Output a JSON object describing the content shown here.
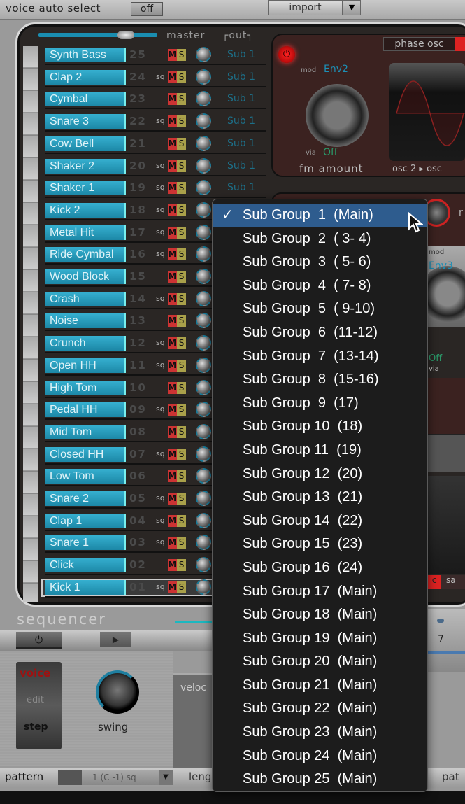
{
  "topbar": {
    "voice_auto_select": "voice auto select",
    "voice_auto_select_value": "off",
    "import_label": "import"
  },
  "mixer": {
    "master_label": "master",
    "out_label": "┌out┐",
    "master_level": 0.7,
    "rows": [
      {
        "name": "Synth Bass",
        "num": "25",
        "sq": false,
        "out": "Sub 1"
      },
      {
        "name": "Clap 2",
        "num": "24",
        "sq": true,
        "out": "Sub 1"
      },
      {
        "name": "Cymbal",
        "num": "23",
        "sq": false,
        "out": "Sub 1"
      },
      {
        "name": "Snare 3",
        "num": "22",
        "sq": true,
        "out": "Sub 1"
      },
      {
        "name": "Cow Bell",
        "num": "21",
        "sq": false,
        "out": "Sub 1"
      },
      {
        "name": "Shaker 2",
        "num": "20",
        "sq": true,
        "out": "Sub 1"
      },
      {
        "name": "Shaker 1",
        "num": "19",
        "sq": true,
        "out": "Sub 1"
      },
      {
        "name": "Kick 2",
        "num": "18",
        "sq": true,
        "out": ""
      },
      {
        "name": "Metal Hit",
        "num": "17",
        "sq": true,
        "out": ""
      },
      {
        "name": "Ride Cymbal",
        "num": "16",
        "sq": true,
        "out": ""
      },
      {
        "name": "Wood Block",
        "num": "15",
        "sq": false,
        "out": ""
      },
      {
        "name": "Crash",
        "num": "14",
        "sq": true,
        "out": ""
      },
      {
        "name": "Noise",
        "num": "13",
        "sq": false,
        "out": ""
      },
      {
        "name": "Crunch",
        "num": "12",
        "sq": true,
        "out": ""
      },
      {
        "name": "Open HH",
        "num": "11",
        "sq": true,
        "out": ""
      },
      {
        "name": "High Tom",
        "num": "10",
        "sq": false,
        "out": ""
      },
      {
        "name": "Pedal HH",
        "num": "09",
        "sq": true,
        "out": ""
      },
      {
        "name": "Mid Tom",
        "num": "08",
        "sq": false,
        "out": ""
      },
      {
        "name": "Closed HH",
        "num": "07",
        "sq": true,
        "out": ""
      },
      {
        "name": "Low Tom",
        "num": "06",
        "sq": false,
        "out": ""
      },
      {
        "name": "Snare 2",
        "num": "05",
        "sq": true,
        "out": ""
      },
      {
        "name": "Clap 1",
        "num": "04",
        "sq": true,
        "out": ""
      },
      {
        "name": "Snare 1",
        "num": "03",
        "sq": true,
        "out": ""
      },
      {
        "name": "Click",
        "num": "02",
        "sq": false,
        "out": ""
      },
      {
        "name": "Kick 1",
        "num": "01",
        "sq": true,
        "out": "",
        "selected": true
      }
    ],
    "mute_label": "M",
    "solo_label": "S",
    "sq_label": "sq"
  },
  "fm": {
    "mod_label": "mod",
    "mod_value": "Env2",
    "via_label": "via",
    "via_value": "Off",
    "title": "fm amount",
    "phase_osc": "phase osc",
    "osc_route": "osc 2 ▸ osc",
    "power_icon": "⏻"
  },
  "right": {
    "r_label": "r",
    "mod_label": "mod",
    "mod_value": "Env3",
    "via_value": "Off",
    "via_label": "via",
    "c_label": "c",
    "sa_label": "sa",
    "step_num": "7"
  },
  "sequencer": {
    "title": "sequencer",
    "power_icon": "⏻",
    "play_icon": "▶",
    "switch": {
      "voice": "voice",
      "edit": "edit",
      "step": "step"
    },
    "swing_label": "swing",
    "velocity_label": "veloc",
    "pattern_label": "pattern",
    "pattern_value": "1 (C -1)  sq",
    "length_label": "leng",
    "pat_label": "pat"
  },
  "menu": {
    "items": [
      "Sub Group  1  (Main)",
      "Sub Group  2  ( 3- 4)",
      "Sub Group  3  ( 5- 6)",
      "Sub Group  4  ( 7- 8)",
      "Sub Group  5  ( 9-10)",
      "Sub Group  6  (11-12)",
      "Sub Group  7  (13-14)",
      "Sub Group  8  (15-16)",
      "Sub Group  9  (17)",
      "Sub Group 10  (18)",
      "Sub Group 11  (19)",
      "Sub Group 12  (20)",
      "Sub Group 13  (21)",
      "Sub Group 14  (22)",
      "Sub Group 15  (23)",
      "Sub Group 16  (24)",
      "Sub Group 17  (Main)",
      "Sub Group 18  (Main)",
      "Sub Group 19  (Main)",
      "Sub Group 20  (Main)",
      "Sub Group 21  (Main)",
      "Sub Group 22  (Main)",
      "Sub Group 23  (Main)",
      "Sub Group 24  (Main)",
      "Sub Group 25  (Main)"
    ],
    "selected_index": 0,
    "check": "✓",
    "highlight_color": "#2e5c8e"
  },
  "colors": {
    "name_field": "#2596b4",
    "mute": "#cc3333",
    "solo": "#a9a04a",
    "panel_red": "#3b2220"
  }
}
